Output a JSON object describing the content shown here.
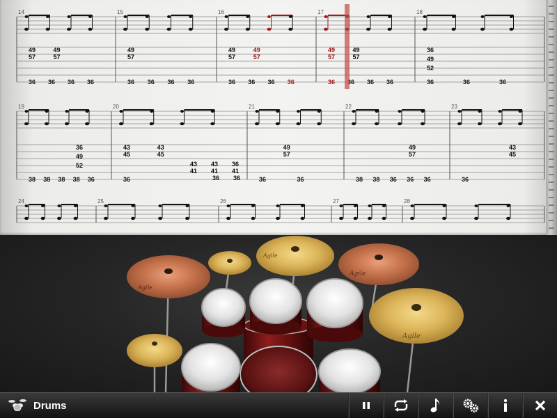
{
  "app": {
    "instrument_label": "Drums"
  },
  "colors": {
    "highlight": "#a01818",
    "ink": "#111111",
    "cursor": "#c85050"
  },
  "score": {
    "rows": [
      {
        "measures": [
          {
            "number": "14",
            "tab": [
              {
                "beat": 0,
                "notes": [
                  "49",
                  "57"
                ]
              },
              {
                "beat": 1,
                "notes": [
                  "49",
                  "57"
                ]
              }
            ],
            "bottom": [
              "36",
              "36",
              "36",
              "36"
            ]
          },
          {
            "number": "15",
            "tab": [
              {
                "beat": 0,
                "notes": [
                  "49",
                  "57"
                ]
              }
            ],
            "bottom": [
              "36",
              "36",
              "36",
              "36"
            ]
          },
          {
            "number": "16",
            "tab": [
              {
                "beat": 0,
                "notes": [
                  "49",
                  "57"
                ]
              },
              {
                "beat": 1,
                "notes": [
                  "49",
                  "57"
                ],
                "hl": true
              }
            ],
            "bottom": [
              "36",
              "36",
              "36",
              "36"
            ],
            "bottom_hl": [
              3
            ]
          },
          {
            "number": "17",
            "tab": [
              {
                "beat": 0,
                "notes": [
                  "49",
                  "57"
                ],
                "hl": true
              },
              {
                "beat": 1,
                "notes": [
                  "49",
                  "57"
                ]
              }
            ],
            "bottom": [
              "36",
              "36",
              "36",
              "36"
            ],
            "bottom_hl": [
              0
            ]
          },
          {
            "number": "18",
            "tab": [
              {
                "beat": 0,
                "notes": [
                  "36",
                  "49",
                  "52"
                ]
              }
            ],
            "bottom": [
              "36",
              "36",
              "36"
            ]
          }
        ]
      },
      {
        "measures": [
          {
            "number": "19",
            "tab": [
              {
                "beat": 2,
                "notes": [
                  "36",
                  "49",
                  "52"
                ]
              }
            ],
            "bottom": [
              "38",
              "38",
              "38",
              "38",
              "36"
            ]
          },
          {
            "number": "20",
            "tab": [
              {
                "beat": 0,
                "notes": [
                  "43",
                  "45"
                ]
              },
              {
                "beat": 1,
                "notes": [
                  "43",
                  "45"
                ]
              }
            ],
            "bottom": [
              "36"
            ],
            "tab2": [
              {
                "notes": [
                  "43",
                  "41"
                ]
              },
              {
                "notes": [
                  "43",
                  "41"
                ]
              },
              {
                "notes": [
                  "36",
                  "41"
                ]
              }
            ],
            "bottom2": [
              "36",
              "36"
            ]
          },
          {
            "number": "21",
            "tab": [
              {
                "beat": 1,
                "notes": [
                  "49",
                  "57"
                ]
              }
            ],
            "bottom": [
              "36",
              "36"
            ]
          },
          {
            "number": "22",
            "tab": [
              {
                "beat": 2,
                "notes": [
                  "49",
                  "57"
                ]
              }
            ],
            "bottom": [
              "38",
              "38",
              "36",
              "36",
              "36"
            ]
          },
          {
            "number": "23",
            "tab": [
              {
                "beat": 2,
                "notes": [
                  "43",
                  "45"
                ]
              }
            ],
            "bottom": [
              "36"
            ]
          }
        ]
      },
      {
        "measures": [
          {
            "number": "24"
          },
          {
            "number": "25"
          },
          {
            "number": "26"
          },
          {
            "number": "27"
          },
          {
            "number": "28"
          }
        ]
      }
    ]
  },
  "kit": {
    "brand": "Agile"
  },
  "toolbar": {
    "buttons": [
      {
        "name": "pause-button",
        "icon": "pause-icon"
      },
      {
        "name": "loop-button",
        "icon": "loop-icon"
      },
      {
        "name": "note-button",
        "icon": "music-note-icon"
      },
      {
        "name": "settings-button",
        "icon": "gears-icon"
      },
      {
        "name": "info-button",
        "icon": "info-icon"
      },
      {
        "name": "close-button",
        "icon": "close-icon"
      }
    ]
  }
}
